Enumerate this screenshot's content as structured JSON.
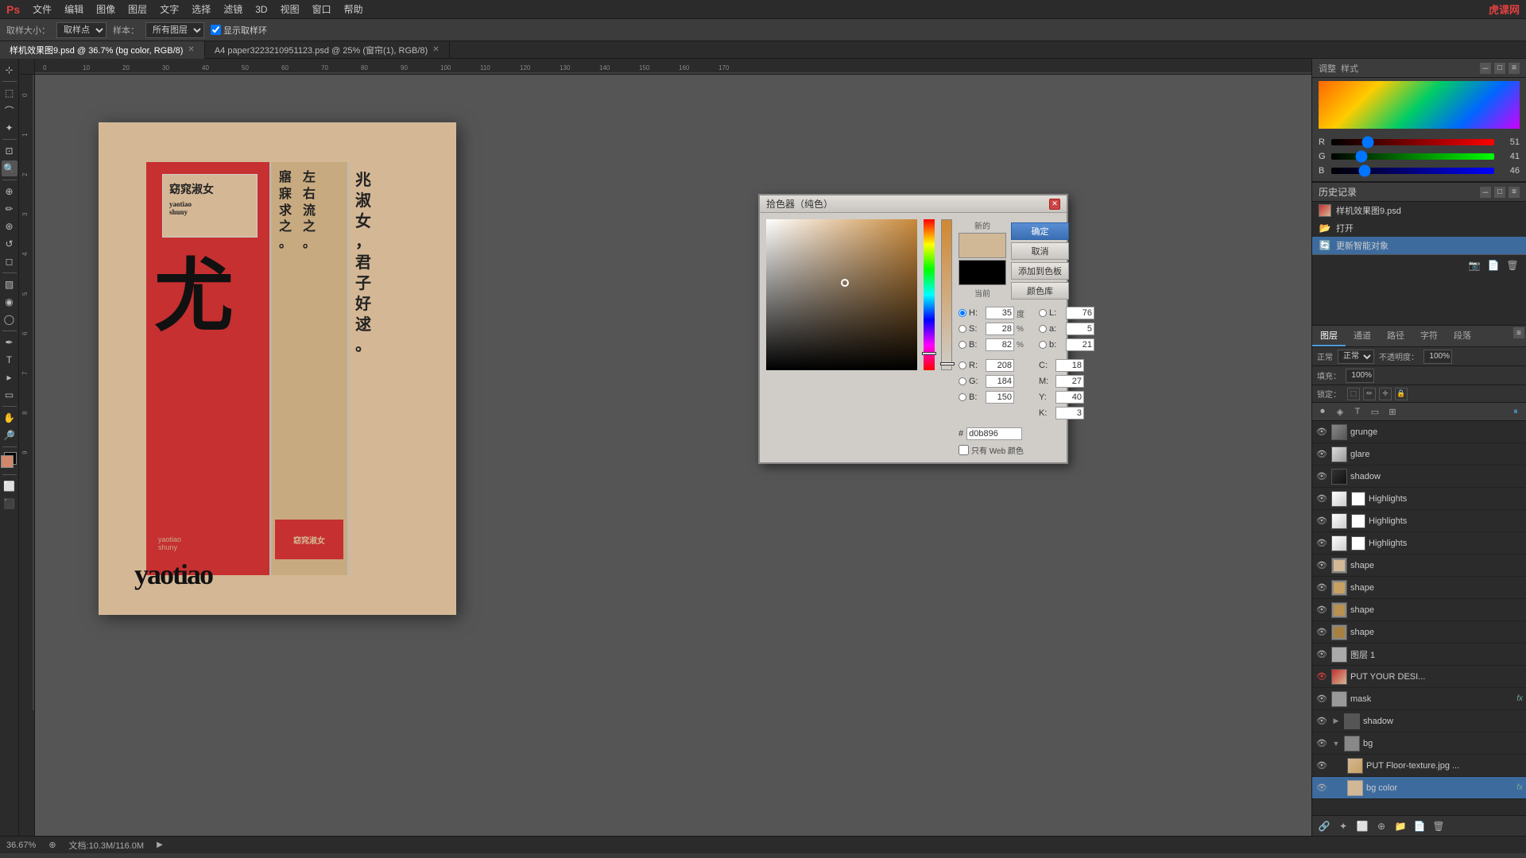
{
  "app": {
    "title": "Adobe Photoshop"
  },
  "menu": {
    "items": [
      "文件",
      "编辑",
      "图像",
      "图层",
      "文字",
      "选择",
      "滤镜",
      "3D",
      "视图",
      "窗口",
      "帮助"
    ]
  },
  "toolbar_options": {
    "sample_size_label": "取样大小：",
    "sample_size_value": "取样点",
    "sample_label": "样本：",
    "sample_value": "所有图层",
    "show_ring_label": "显示取样环",
    "show_ring_checked": true
  },
  "tabs": [
    {
      "id": "tab1",
      "label": "样机效果图9.psd @ 36.7% (bg color, RGB/8)",
      "active": true
    },
    {
      "id": "tab2",
      "label": "A4 paper3223210951123.psd @ 25% (窗帘(1), RGB/8)",
      "active": false
    }
  ],
  "history_panel": {
    "title": "历史记录",
    "items": [
      {
        "id": "h1",
        "type": "thumb",
        "label": "样机效果图9.psd",
        "selected": false
      },
      {
        "id": "h2",
        "type": "icon",
        "label": "打开",
        "icon": "📂",
        "selected": false
      },
      {
        "id": "h3",
        "type": "icon",
        "label": "更新智能对象",
        "icon": "🔄",
        "selected": true
      }
    ]
  },
  "color_panel": {
    "r_value": "51",
    "g_value": "41",
    "b_value": "46",
    "r_label": "R",
    "g_label": "G",
    "b_label": "B"
  },
  "layers_panel": {
    "title": "图层",
    "tabs": [
      "图层",
      "通道",
      "路径",
      "字符",
      "段落"
    ],
    "active_tab": "图层",
    "blend_mode": "正常",
    "opacity_label": "不透明度：",
    "opacity_value": "100%",
    "fill_label": "填充：",
    "fill_value": "100%",
    "lock_label": "锁定：",
    "layers": [
      {
        "id": "l_grunge",
        "name": "grunge",
        "visible": true,
        "indent": 0,
        "type": "normal",
        "has_fx": false,
        "selected": false
      },
      {
        "id": "l_glare",
        "name": "glare",
        "visible": true,
        "indent": 0,
        "type": "normal",
        "has_fx": false,
        "selected": false
      },
      {
        "id": "l_shadow",
        "name": "shadow",
        "visible": true,
        "indent": 0,
        "type": "normal",
        "has_fx": false,
        "selected": false
      },
      {
        "id": "l_highlights1",
        "name": "Highlights",
        "visible": true,
        "indent": 0,
        "type": "normal",
        "has_fx": false,
        "selected": false
      },
      {
        "id": "l_highlights2",
        "name": "Highlights",
        "visible": true,
        "indent": 0,
        "type": "normal",
        "has_fx": false,
        "selected": false
      },
      {
        "id": "l_highlights3",
        "name": "Highlights",
        "visible": true,
        "indent": 0,
        "type": "normal",
        "has_fx": false,
        "selected": false
      },
      {
        "id": "l_shape1",
        "name": "shape",
        "visible": true,
        "indent": 0,
        "type": "shape",
        "has_fx": false,
        "selected": false
      },
      {
        "id": "l_shape2",
        "name": "shape",
        "visible": true,
        "indent": 0,
        "type": "shape",
        "has_fx": false,
        "selected": false
      },
      {
        "id": "l_shape3",
        "name": "shape",
        "visible": true,
        "indent": 0,
        "type": "shape",
        "has_fx": false,
        "selected": false
      },
      {
        "id": "l_shape4",
        "name": "shape",
        "visible": true,
        "indent": 0,
        "type": "shape",
        "has_fx": false,
        "selected": false
      },
      {
        "id": "l_layer1",
        "name": "图层 1",
        "visible": true,
        "indent": 0,
        "type": "normal",
        "has_fx": false,
        "selected": false
      },
      {
        "id": "l_put_your_desi",
        "name": "PUT YOUR DESI...",
        "visible": true,
        "indent": 0,
        "type": "smart",
        "has_fx": false,
        "selected": false
      },
      {
        "id": "l_mask",
        "name": "mask",
        "visible": true,
        "indent": 0,
        "type": "normal",
        "has_fx": true,
        "selected": false
      },
      {
        "id": "l_shadow_group",
        "name": "shadow",
        "visible": true,
        "indent": 0,
        "type": "group",
        "has_fx": false,
        "selected": false
      },
      {
        "id": "l_bg_group",
        "name": "bg",
        "visible": true,
        "indent": 0,
        "type": "group",
        "has_fx": false,
        "selected": false
      },
      {
        "id": "l_put_floor",
        "name": "PUT Floor-texture.jpg ...",
        "visible": true,
        "indent": 1,
        "type": "smart",
        "has_fx": false,
        "selected": false
      },
      {
        "id": "l_bg_color",
        "name": "bg color",
        "visible": true,
        "indent": 1,
        "type": "normal",
        "has_fx": true,
        "selected": true
      }
    ]
  },
  "color_picker_dialog": {
    "title": "拾色器（纯色）",
    "new_label": "新的",
    "current_label": "当前",
    "ok_label": "确定",
    "cancel_label": "取消",
    "add_to_swatches_label": "添加到色板",
    "color_libraries_label": "颜色库",
    "h_label": "H:",
    "h_value": "35",
    "h_unit": "度",
    "s_label": "S:",
    "s_value": "28",
    "s_unit": "%",
    "b_label": "B:",
    "b_value": "82",
    "b_unit": "%",
    "l_label": "L:",
    "l_value": "76",
    "a_label": "a:",
    "a_value": "5",
    "b2_label": "b:",
    "b2_value": "21",
    "r_label": "R:",
    "r_value": "208",
    "c_label": "C:",
    "c_value": "18",
    "c_unit": "%",
    "g_label": "G:",
    "g_value": "184",
    "m_label": "M:",
    "m_value": "27",
    "m_unit": "%",
    "b3_label": "B:",
    "b3_value": "150",
    "y_label": "Y:",
    "y_value": "40",
    "y_unit": "%",
    "k_label": "K:",
    "k_value": "3",
    "k_unit": "%",
    "hex_label": "#",
    "hex_value": "d0b896",
    "web_only_label": "只有 Web 颜色",
    "new_color": "#d0b896",
    "current_color": "#000000"
  },
  "status_bar": {
    "zoom": "36.67%",
    "doc_info": "文档:10.3M/116.0M"
  },
  "canvas": {
    "bg_color": "#d4b896"
  }
}
